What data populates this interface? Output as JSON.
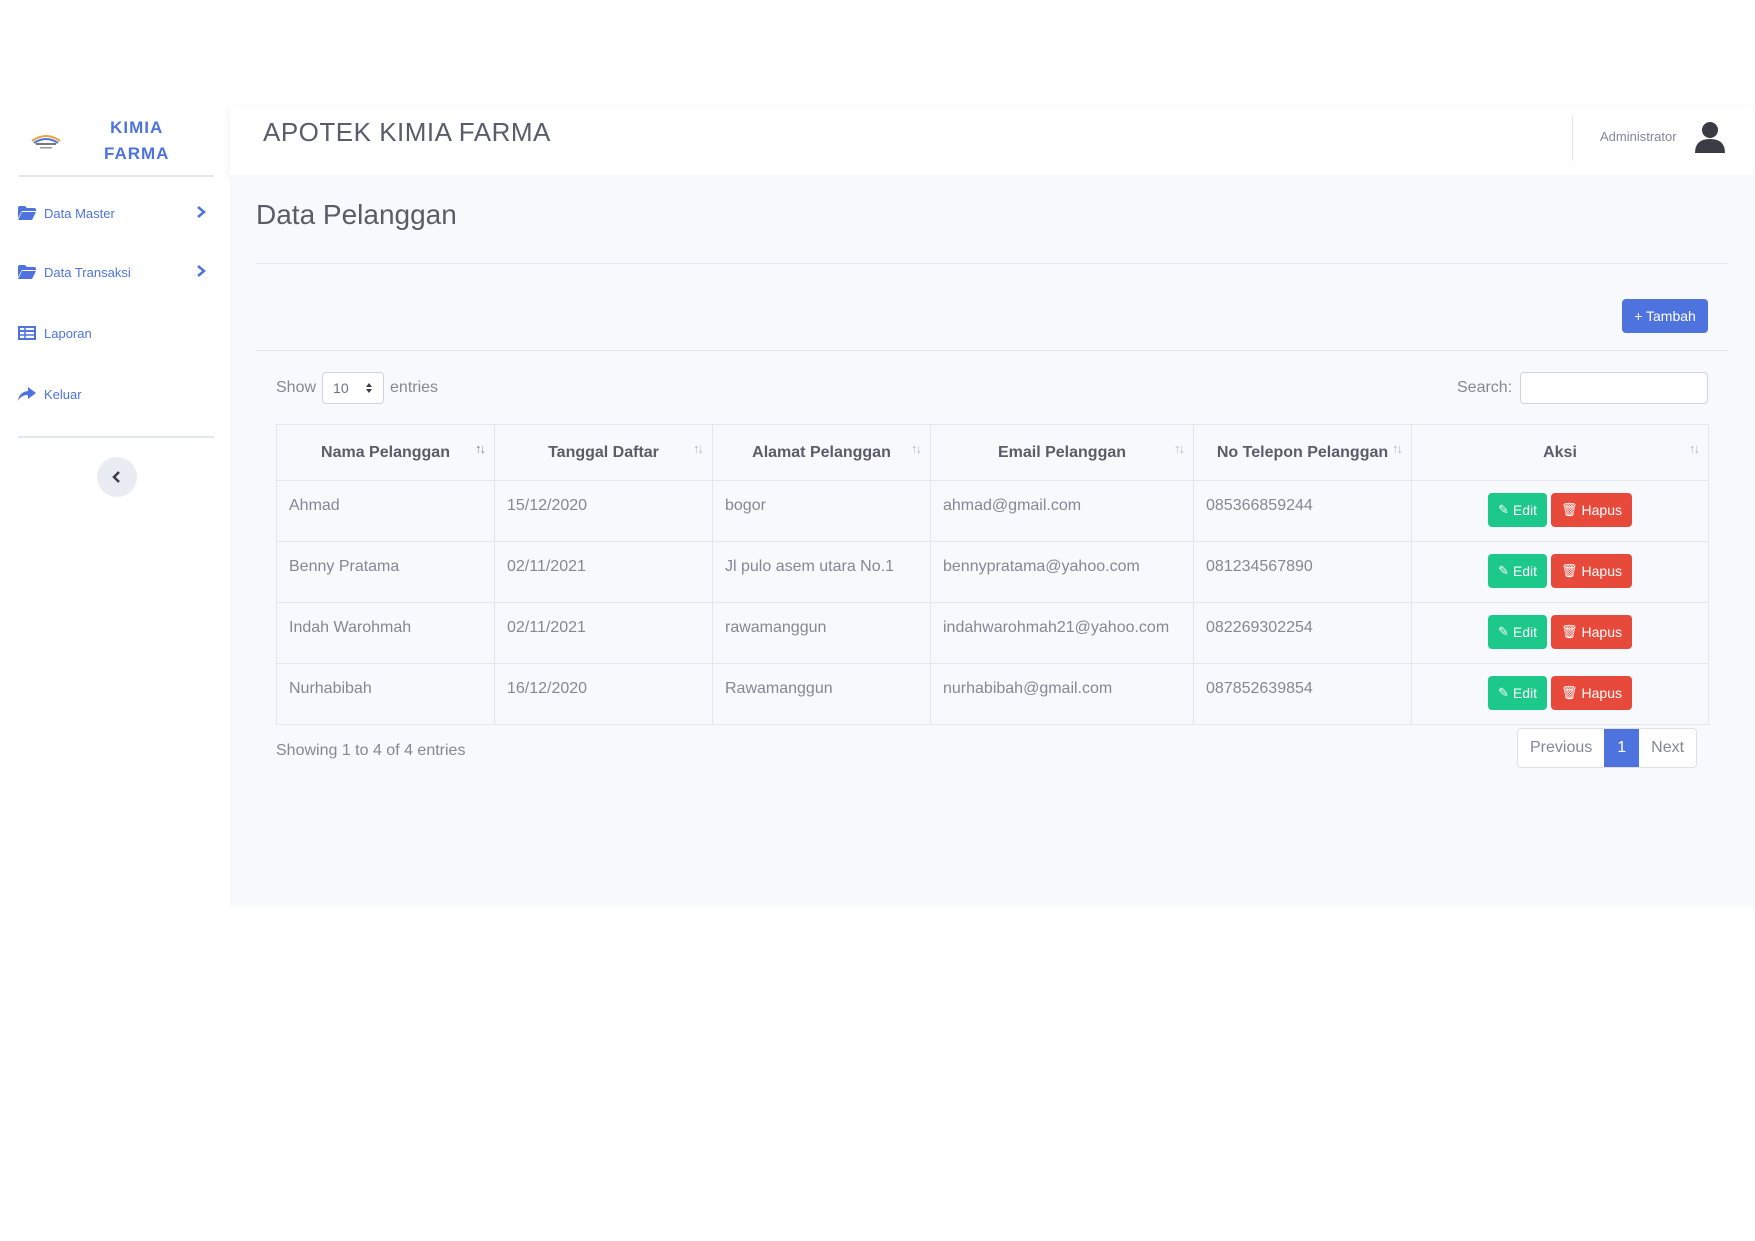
{
  "brand": {
    "line1": "KIMIA",
    "line2": "FARMA"
  },
  "topbar": {
    "title": "APOTEK KIMIA FARMA",
    "user": "Administrator",
    "user_icon": "user-icon"
  },
  "sidebar": {
    "items": [
      {
        "label": "Data Master",
        "icon": "folder-icon",
        "has_chevron": true
      },
      {
        "label": "Data Transaksi",
        "icon": "folder-icon",
        "has_chevron": true
      },
      {
        "label": "Laporan",
        "icon": "table-icon",
        "has_chevron": false
      },
      {
        "label": "Keluar",
        "icon": "share-icon",
        "has_chevron": false
      }
    ],
    "toggle_icon": "chevron-left-icon"
  },
  "page": {
    "title": "Data Pelanggan",
    "add_label": "+ Tambah"
  },
  "table_controls": {
    "show_label": "Show",
    "entries_value": "10",
    "entries_label": "entries",
    "search_label": "Search:",
    "search_value": ""
  },
  "table": {
    "headers": [
      "Nama Pelanggan",
      "Tanggal Daftar",
      "Alamat Pelanggan",
      "Email Pelanggan",
      "No Telepon Pelanggan",
      "Aksi"
    ],
    "rows": [
      [
        "Ahmad",
        "15/12/2020",
        "bogor",
        "ahmad@gmail.com",
        "085366859244"
      ],
      [
        "Benny Pratama",
        "02/11/2021",
        "Jl pulo asem utara No.1",
        "bennypratama@yahoo.com",
        "081234567890"
      ],
      [
        "Indah Warohmah",
        "02/11/2021",
        "rawamanggun",
        "indahwarohmah21@yahoo.com",
        "082269302254"
      ],
      [
        "Nurhabibah",
        "16/12/2020",
        "Rawamanggun",
        "nurhabibah@gmail.com",
        "087852639854"
      ]
    ],
    "edit_label": "Edit",
    "delete_label": "Hapus"
  },
  "footer": {
    "info": "Showing 1 to 4 of 4 entries",
    "prev": "Previous",
    "page": "1",
    "next": "Next"
  },
  "colors": {
    "primary": "#4e73df",
    "success": "#1cc88a",
    "danger": "#e74a3b",
    "text": "#858796",
    "heading": "#5a5c69"
  }
}
